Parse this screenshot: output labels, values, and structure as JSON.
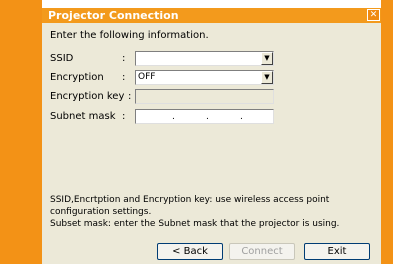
{
  "window": {
    "title": "Projector Connection",
    "close_glyph": "✕"
  },
  "instruction": "Enter the following information.",
  "fields": {
    "ssid": {
      "label": "SSID",
      "colon": ":",
      "value": ""
    },
    "encryption": {
      "label": "Encryption",
      "colon": ":",
      "value": "OFF"
    },
    "encryption_key": {
      "label": "Encryption key",
      "colon": ":",
      "value": ""
    },
    "subnet_mask": {
      "label": "Subnet mask",
      "colon": ":",
      "dot1": ".",
      "dot2": ".",
      "dot3": "."
    }
  },
  "help": {
    "line1": "SSID,Encrtption and Encryption key: use wireless access point",
    "line2": "configuration settings.",
    "line3": "Subset mask: enter the Subnet mask that the projector is using."
  },
  "buttons": {
    "back": "< Back",
    "connect": "Connect",
    "exit": "Exit"
  },
  "icons": {
    "dropdown": "▼"
  },
  "colors": {
    "accent": "#f39216",
    "dialog_bg": "#ece9d8"
  }
}
